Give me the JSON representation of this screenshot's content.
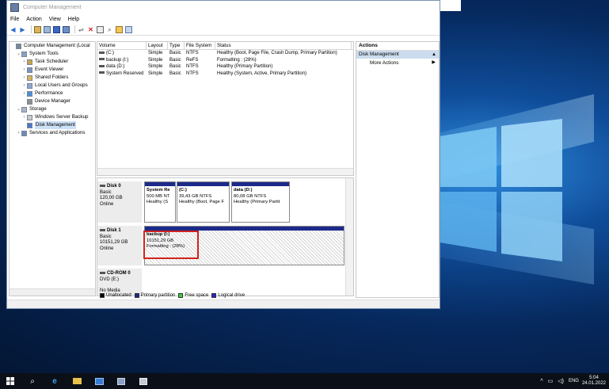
{
  "window": {
    "title": "Computer Management",
    "menu": [
      "File",
      "Action",
      "View",
      "Help"
    ]
  },
  "tree": {
    "items": [
      {
        "label": "Computer Management (Local",
        "level": 0,
        "expander": "",
        "selected": false
      },
      {
        "label": "System Tools",
        "level": 1,
        "expander": "v",
        "selected": false
      },
      {
        "label": "Task Scheduler",
        "level": 2,
        "expander": ">",
        "selected": false
      },
      {
        "label": "Event Viewer",
        "level": 2,
        "expander": ">",
        "selected": false
      },
      {
        "label": "Shared Folders",
        "level": 2,
        "expander": ">",
        "selected": false
      },
      {
        "label": "Local Users and Groups",
        "level": 2,
        "expander": ">",
        "selected": false
      },
      {
        "label": "Performance",
        "level": 2,
        "expander": ">",
        "selected": false
      },
      {
        "label": "Device Manager",
        "level": 2,
        "expander": "",
        "selected": false
      },
      {
        "label": "Storage",
        "level": 1,
        "expander": "v",
        "selected": false
      },
      {
        "label": "Windows Server Backup",
        "level": 2,
        "expander": ">",
        "selected": false
      },
      {
        "label": "Disk Management",
        "level": 2,
        "expander": "",
        "selected": true
      },
      {
        "label": "Services and Applications",
        "level": 1,
        "expander": ">",
        "selected": false
      }
    ]
  },
  "volumes": {
    "headers": [
      "Volume",
      "Layout",
      "Type",
      "File System",
      "Status"
    ],
    "rows": [
      [
        "(C:)",
        "Simple",
        "Basic",
        "NTFS",
        "Healthy (Boot, Page File, Crash Dump, Primary Partition)"
      ],
      [
        "backup (I:)",
        "Simple",
        "Basic",
        "ReFS",
        "Formatting : (28%)"
      ],
      [
        "data (D:)",
        "Simple",
        "Basic",
        "NTFS",
        "Healthy (Primary Partition)"
      ],
      [
        "System Reserved",
        "Simple",
        "Basic",
        "NTFS",
        "Healthy (System, Active, Primary Partition)"
      ]
    ]
  },
  "disks": {
    "disk0": {
      "name": "Disk 0",
      "type": "Basic",
      "size": "120,00 GB",
      "status": "Online",
      "parts": [
        {
          "name": "System Re",
          "size": "500 MB NT",
          "status": "Healthy (S"
        },
        {
          "name": "(C:)",
          "size": "39,43 GB NTFS",
          "status": "Healthy (Boot, Page F"
        },
        {
          "name": "data (D:)",
          "size": "80,08 GB NTFS",
          "status": "Healthy (Primary Partit"
        }
      ]
    },
    "disk1": {
      "name": "Disk 1",
      "type": "Basic",
      "size": "10151,29 GB",
      "status": "Online",
      "part": {
        "name": "backup (I:)",
        "size": "10151,29 GB",
        "status": "Formatting : (28%)"
      }
    },
    "cdrom": {
      "name": "CD-ROM 0",
      "type": "DVD (E:)",
      "status": "No Media"
    }
  },
  "legend": [
    {
      "label": "Unallocated",
      "color": "#000000"
    },
    {
      "label": "Primary partition",
      "color": "#1c2a8a"
    },
    {
      "label": "Free space",
      "color": "#3fcf3f"
    },
    {
      "label": "Logical drive",
      "color": "#2525c8"
    }
  ],
  "actions": {
    "header": "Actions",
    "section": "Disk Management",
    "item": "More Actions"
  },
  "taskbar": {
    "lang": "ENG",
    "time": "5:04",
    "date": "24.01.2022"
  }
}
